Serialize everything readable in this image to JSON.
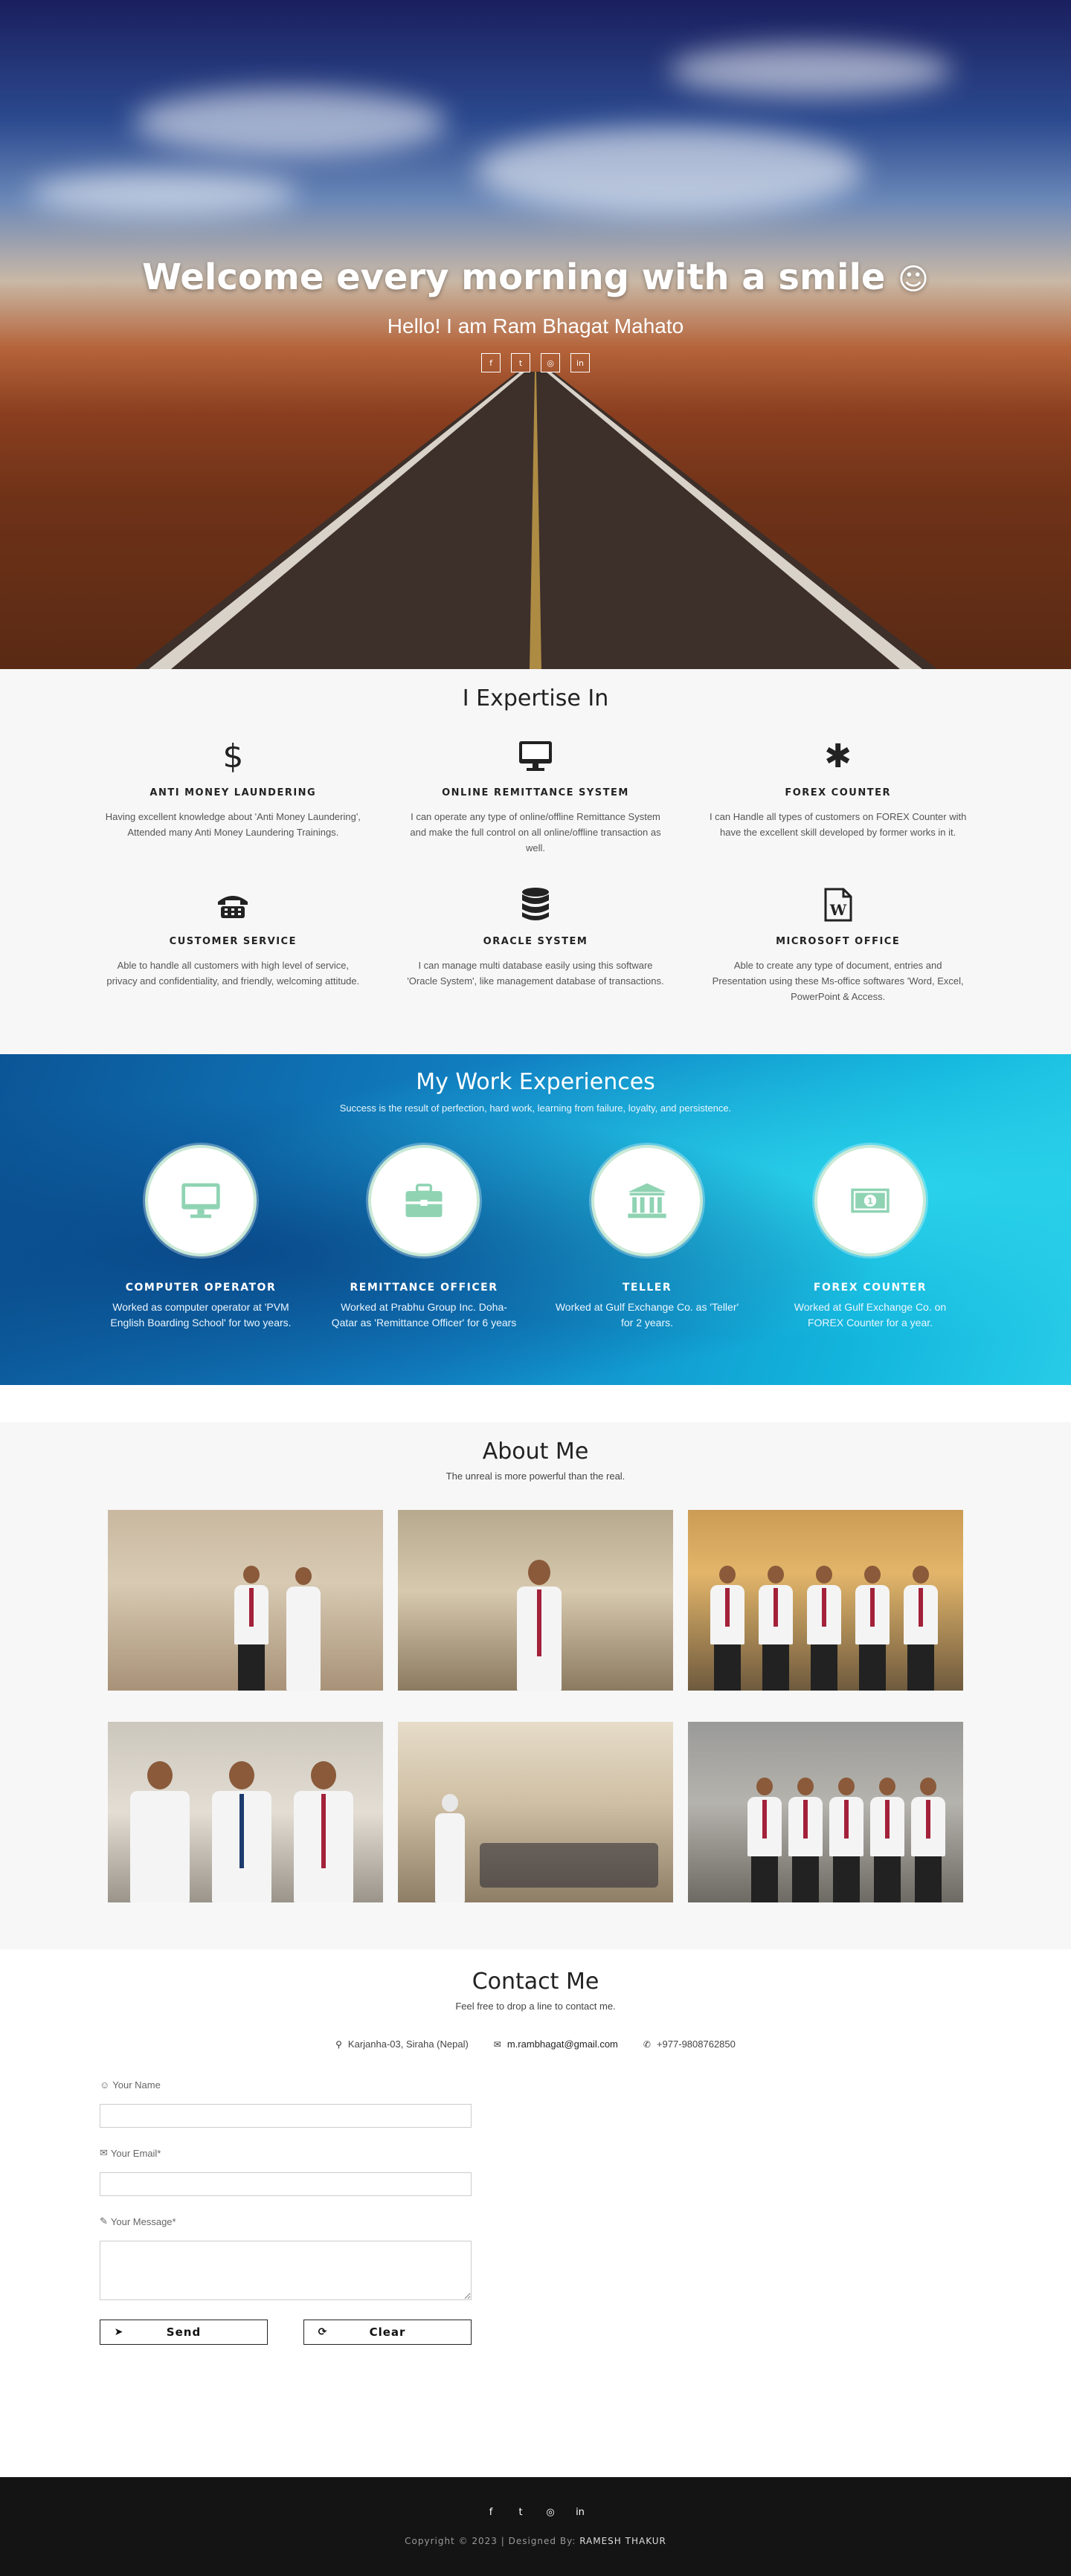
{
  "hero": {
    "title": "Welcome every morning with a smile",
    "smiley": "☺",
    "subtitle": "Hello! I am Ram Bhagat Mahato",
    "social": [
      {
        "icon": "facebook-icon",
        "glyph": "f"
      },
      {
        "icon": "twitter-icon",
        "glyph": "t"
      },
      {
        "icon": "instagram-icon",
        "glyph": "◎"
      },
      {
        "icon": "linkedin-icon",
        "glyph": "in"
      }
    ]
  },
  "expertise": {
    "title": "I Expertise In",
    "items": [
      {
        "icon": "dollar-icon",
        "glyph": "$",
        "title": "ANTI MONEY LAUNDERING",
        "desc": "Having excellent knowledge about 'Anti Money Laundering', Attended many Anti Money Laundering Trainings."
      },
      {
        "icon": "desktop-icon",
        "glyph": "🖥",
        "title": "ONLINE REMITTANCE SYSTEM",
        "desc": "I can operate any type of online/offline Remittance System and make the full control on all online/offline transaction as well."
      },
      {
        "icon": "asterisk-icon",
        "glyph": "✱",
        "title": "FOREX COUNTER",
        "desc": "I can Handle all types of customers on FOREX Counter with have the excellent skill developed by former works in it."
      },
      {
        "icon": "fax-icon",
        "glyph": "☎",
        "title": "CUSTOMER SERVICE",
        "desc": "Able to handle all customers with high level of service, privacy and confidentiality, and friendly, welcoming attitude."
      },
      {
        "icon": "database-icon",
        "glyph": "⛁",
        "title": "ORACLE SYSTEM",
        "desc": "I can manage multi database easily using this software 'Oracle System', like management database of transactions."
      },
      {
        "icon": "word-file-icon",
        "glyph": "W",
        "title": "MICROSOFT OFFICE",
        "desc": "Able to create any type of document, entries and Presentation using these Ms-office softwares 'Word, Excel, PowerPoint & Access."
      }
    ]
  },
  "work": {
    "title": "My Work Experiences",
    "subtitle": "Success is the result of perfection, hard work, learning from failure, loyalty, and persistence.",
    "accent": "#8fd3b3",
    "items": [
      {
        "icon": "desktop-icon",
        "title": "COMPUTER OPERATOR",
        "desc": "Worked as computer operator at 'PVM English Boarding School' for two years."
      },
      {
        "icon": "briefcase-icon",
        "title": "REMITTANCE OFFICER",
        "desc": "Worked at Prabhu Group Inc. Doha-Qatar as 'Remittance Officer' for 6 years"
      },
      {
        "icon": "bank-icon",
        "title": "TELLER",
        "desc": "Worked at Gulf Exchange Co. as 'Teller' for 2 years."
      },
      {
        "icon": "money-icon",
        "title": "FOREX COUNTER",
        "desc": "Worked at Gulf Exchange Co. on FOREX Counter for a year."
      }
    ]
  },
  "about": {
    "title": "About Me",
    "subtitle": "The unreal is more powerful than the real."
  },
  "contact": {
    "title": "Contact Me",
    "subtitle": "Feel free to drop a line to contact me.",
    "address": "Karjanha-03, Siraha (Nepal)",
    "email": "m.rambhagat@gmail.com",
    "phone": "+977-9808762850",
    "form": {
      "name_label": "Your Name",
      "email_label": "Your Email*",
      "message_label": "Your Message*",
      "send_label": "Send",
      "clear_label": "Clear"
    }
  },
  "footer": {
    "copyright": "Copyright © 2023 | Designed By:",
    "author": "RAMESH THAKUR"
  }
}
